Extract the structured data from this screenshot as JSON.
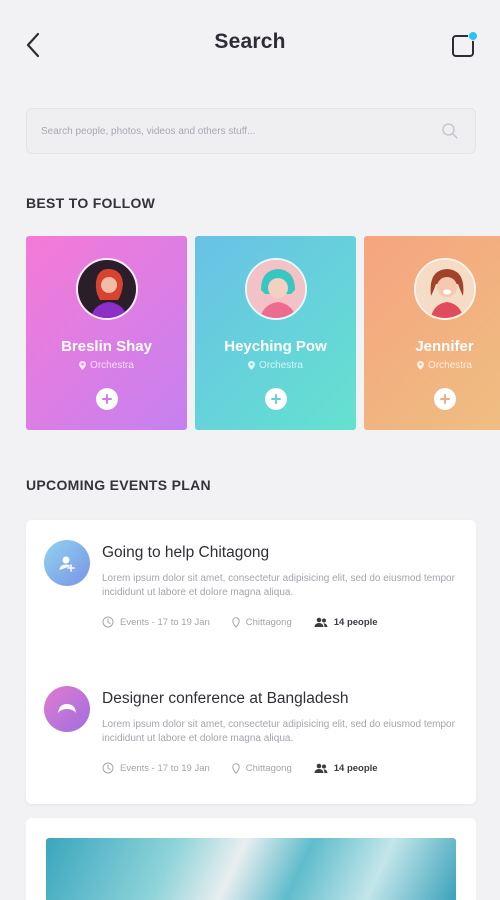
{
  "header": {
    "title": "Search"
  },
  "search": {
    "placeholder": "Search people, photos, videos and others stuff..."
  },
  "best_to_follow": {
    "title": "BEST TO FOLLOW",
    "people": [
      {
        "name": "Breslin Shay",
        "location": "Orchestra"
      },
      {
        "name": "Heyching Pow",
        "location": "Orchestra"
      },
      {
        "name": "Jennifer",
        "location": "Orchestra"
      }
    ]
  },
  "events": {
    "title": "UPCOMING EVENTS PLAN",
    "items": [
      {
        "title": "Going to help Chitagong",
        "description": "Lorem ipsum dolor sit amet, consectetur adipisicing elit, sed do eiusmod tempor incididunt ut labore et dolore magna aliqua.",
        "date": "Events - 17 to 19 Jan",
        "location": "Chittagong",
        "people": "14 people"
      },
      {
        "title": "Designer conference at Bangladesh",
        "description": "Lorem ipsum dolor sit amet, consectetur adipisicing elit, sed do eiusmod tempor incididunt ut labore et dolore magna aliqua.",
        "date": "Events - 17 to 19 Jan",
        "location": "Chittagong",
        "people": "14 people"
      }
    ]
  },
  "icons": {
    "back": "chevron-left-icon",
    "compose": "compose-icon",
    "search": "search-icon",
    "location": "map-pin-icon",
    "add": "plus-icon",
    "clock": "clock-icon",
    "people": "people-icon"
  },
  "colors": {
    "card_pink": "#f57ad7",
    "card_teal": "#69c1e6",
    "card_orange": "#f6a47f",
    "notification_dot": "#27c4f5"
  }
}
